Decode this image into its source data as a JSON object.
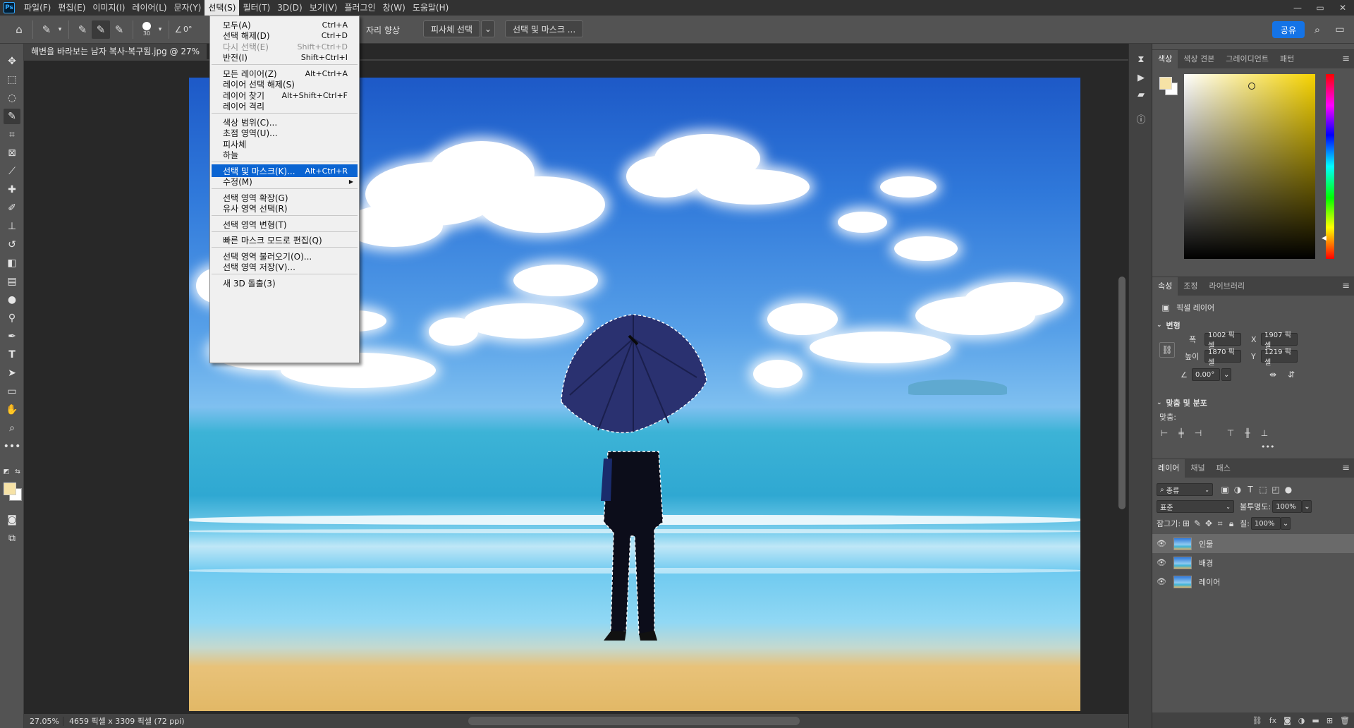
{
  "menubar": {
    "logo": "Ps",
    "items": [
      "파일(F)",
      "편집(E)",
      "이미지(I)",
      "레이어(L)",
      "문자(Y)",
      "선택(S)",
      "필터(T)",
      "3D(D)",
      "보기(V)",
      "플러그인",
      "창(W)",
      "도움말(H)"
    ],
    "active_index": 5,
    "window_controls": [
      "—",
      "▭",
      "✕"
    ]
  },
  "options": {
    "brush_size": "30",
    "angle": "0°",
    "enhance_edge_partial": "자리 향상",
    "subject_select": "피사체 선택",
    "select_and_mask": "선택 및 마스크 ...",
    "share": "공유",
    "icons": {
      "home": "home-icon",
      "tool_preset": "quick-select-icon",
      "new_selection": "new-selection-icon",
      "add_selection": "add-selection-icon",
      "subtract_selection": "subtract-selection-icon",
      "search": "search-icon",
      "workspace": "workspace-icon"
    }
  },
  "document": {
    "tab_title": "해변을 바라보는 남자 복사-복구됨.jpg @ 27%",
    "status_zoom": "27.05%",
    "status_info": "4659 픽셀 x 3309 픽셀 (72 ppi)"
  },
  "select_menu": {
    "items": [
      {
        "label": "모두(A)",
        "shortcut": "Ctrl+A",
        "disabled": false
      },
      {
        "label": "선택 해제(D)",
        "shortcut": "Ctrl+D",
        "disabled": false
      },
      {
        "label": "다시 선택(E)",
        "shortcut": "Shift+Ctrl+D",
        "disabled": true
      },
      {
        "label": "반전(I)",
        "shortcut": "Shift+Ctrl+I",
        "disabled": false
      },
      {
        "sep": true
      },
      {
        "label": "모든 레이어(Z)",
        "shortcut": "Alt+Ctrl+A",
        "disabled": false
      },
      {
        "label": "레이어 선택 해제(S)",
        "shortcut": "",
        "disabled": false
      },
      {
        "label": "레이어 찾기",
        "shortcut": "Alt+Shift+Ctrl+F",
        "disabled": false
      },
      {
        "label": "레이어 격리",
        "shortcut": "",
        "disabled": false
      },
      {
        "sep": true
      },
      {
        "label": "색상 범위(C)...",
        "shortcut": "",
        "disabled": false
      },
      {
        "label": "초점 영역(U)...",
        "shortcut": "",
        "disabled": false
      },
      {
        "label": "피사체",
        "shortcut": "",
        "disabled": false
      },
      {
        "label": "하늘",
        "shortcut": "",
        "disabled": false
      },
      {
        "sep": true
      },
      {
        "label": "선택 및 마스크(K)...",
        "shortcut": "Alt+Ctrl+R",
        "disabled": false,
        "highlight": true
      },
      {
        "label": "수정(M)",
        "shortcut": "",
        "disabled": false,
        "submenu": true
      },
      {
        "sep": true
      },
      {
        "label": "선택 영역 확장(G)",
        "shortcut": "",
        "disabled": false
      },
      {
        "label": "유사 영역 선택(R)",
        "shortcut": "",
        "disabled": false
      },
      {
        "sep": true
      },
      {
        "label": "선택 영역 변형(T)",
        "shortcut": "",
        "disabled": false
      },
      {
        "sep": true
      },
      {
        "label": "빠른 마스크 모드로 편집(Q)",
        "shortcut": "",
        "disabled": false
      },
      {
        "sep": true
      },
      {
        "label": "선택 영역 불러오기(O)...",
        "shortcut": "",
        "disabled": false
      },
      {
        "label": "선택 영역 저장(V)...",
        "shortcut": "",
        "disabled": false
      },
      {
        "sep": true
      },
      {
        "label": "새 3D 돌출(3)",
        "shortcut": "",
        "disabled": false
      }
    ]
  },
  "color_panel": {
    "tabs": [
      "색상",
      "색상 견본",
      "그레이디언트",
      "패턴"
    ],
    "foreground": "#f6e2a6",
    "background": "#ffffff"
  },
  "properties_panel": {
    "tabs": [
      "속성",
      "조정",
      "라이브러리"
    ],
    "layer_type": "픽셀 레이어",
    "transform_title": "변형",
    "w_label": "폭",
    "w_value": "1002 픽셀",
    "x_label": "X",
    "x_value": "1907 픽셀",
    "h_label": "높이",
    "h_value": "1870 픽셀",
    "y_label": "Y",
    "y_value": "1219 픽셀",
    "angle_value": "0.00°",
    "align_title": "맞춤 및 분포",
    "align_label": "맞춤:",
    "more": "•••"
  },
  "layers_panel": {
    "tabs": [
      "레이어",
      "채널",
      "패스"
    ],
    "filter_kind": "종류",
    "blend_mode": "표준",
    "opacity_label": "불투명도:",
    "opacity_value": "100%",
    "lock_label": "잠그기:",
    "fill_label": "칠:",
    "fill_value": "100%",
    "layers": [
      {
        "name": "인물",
        "selected": true
      },
      {
        "name": "배경",
        "selected": false
      },
      {
        "name": "레이어",
        "selected": false
      }
    ]
  }
}
